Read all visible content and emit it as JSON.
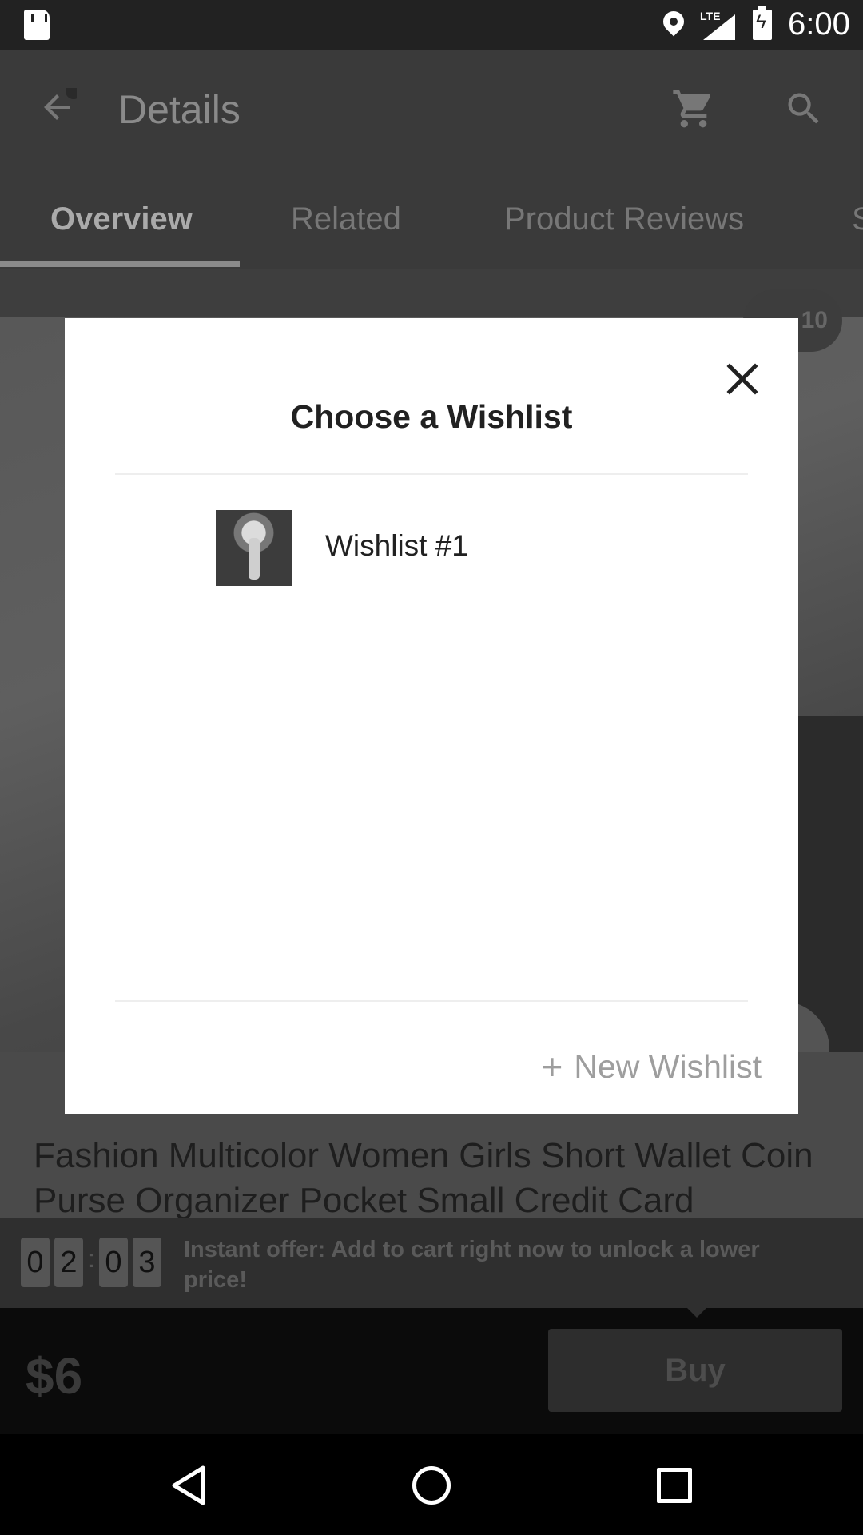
{
  "status_bar": {
    "network_label": "LTE",
    "time": "6:00"
  },
  "app_bar": {
    "title": "Details"
  },
  "tabs": [
    {
      "label": "Overview",
      "active": true
    },
    {
      "label": "Related",
      "active": false
    },
    {
      "label": "Product Reviews",
      "active": false
    },
    {
      "label": "S",
      "active": false
    }
  ],
  "product": {
    "image_count": "10",
    "title": "Fashion Multicolor Women Girls Short Wallet Coin Purse Organizer Pocket Small Credit Card"
  },
  "offer": {
    "timer_digits": [
      "0",
      "2",
      "0",
      "3"
    ],
    "timer_separator": ":",
    "text": "Instant offer: Add to cart right now to unlock a lower price!"
  },
  "purchase": {
    "price": "$6",
    "buy_label": "Buy"
  },
  "dialog": {
    "title": "Choose a Wishlist",
    "wishlists": [
      {
        "name": "Wishlist #1"
      }
    ],
    "new_wishlist_label": "New Wishlist",
    "new_wishlist_icon": "+"
  },
  "colors": {
    "overlay": "#3a3a3a",
    "dialog_bg": "#ffffff",
    "muted_text": "#9e9e9e"
  }
}
